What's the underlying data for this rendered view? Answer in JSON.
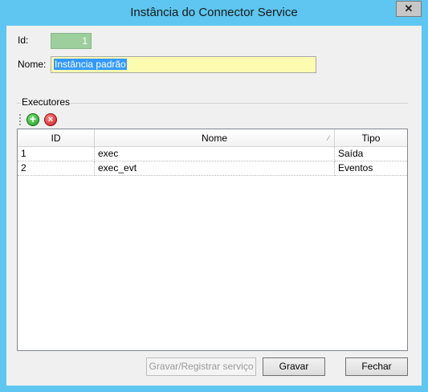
{
  "window": {
    "title": "Instância do Connector Service",
    "close_glyph": "✕"
  },
  "form": {
    "id_label": "Id:",
    "id_value": "1",
    "name_label": "Nome:",
    "name_value": "Instância padrão"
  },
  "executors": {
    "group_label": "Executores",
    "columns": [
      "ID",
      "Nome",
      "Tipo"
    ],
    "sort_glyph": "⁄",
    "rows": [
      {
        "id": "1",
        "nome": "exec",
        "tipo": "Saída"
      },
      {
        "id": "2",
        "nome": "exec_evt",
        "tipo": "Eventos"
      }
    ]
  },
  "buttons": {
    "register": "Gravar/Registrar serviço",
    "save": "Gravar",
    "close": "Fechar"
  },
  "icons": {
    "add": "add-circle-icon",
    "delete": "delete-circle-icon"
  }
}
